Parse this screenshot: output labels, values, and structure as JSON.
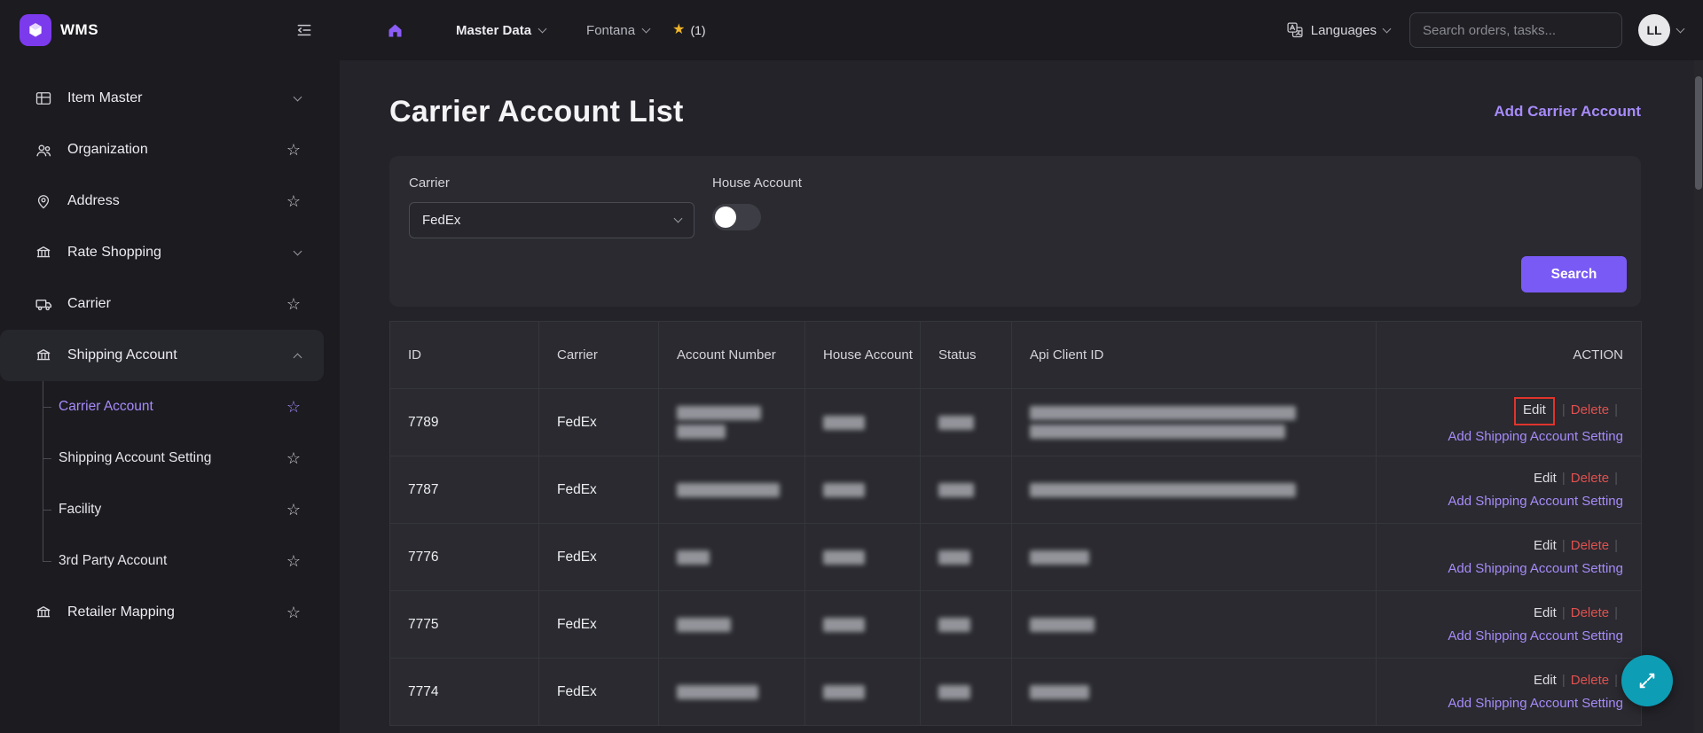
{
  "app": {
    "name": "WMS"
  },
  "topbar": {
    "master_data": "Master Data",
    "facility": "Fontana",
    "favorites_count": "(1)",
    "languages_label": "Languages",
    "search_placeholder": "Search orders, tasks...",
    "avatar_initials": "LL"
  },
  "sidebar": {
    "items": [
      {
        "label": "Item Master",
        "icon": "grid-icon",
        "trailing": "chevron-down"
      },
      {
        "label": "Organization",
        "icon": "team-icon",
        "trailing": "star"
      },
      {
        "label": "Address",
        "icon": "map-pin-icon",
        "trailing": "star"
      },
      {
        "label": "Rate Shopping",
        "icon": "bank-icon",
        "trailing": "chevron-down"
      },
      {
        "label": "Carrier",
        "icon": "truck-icon",
        "trailing": "star"
      },
      {
        "label": "Shipping Account",
        "icon": "bank-icon",
        "trailing": "chevron-up",
        "expanded": true
      },
      {
        "label": "Retailer Mapping",
        "icon": "bank-icon",
        "trailing": "star"
      }
    ],
    "shipping_children": [
      {
        "label": "Carrier Account",
        "active": true
      },
      {
        "label": "Shipping Account Setting"
      },
      {
        "label": "Facility"
      },
      {
        "label": "3rd Party Account"
      }
    ]
  },
  "page": {
    "title": "Carrier Account List",
    "add_link": "Add Carrier Account"
  },
  "filters": {
    "carrier_label": "Carrier",
    "carrier_value": "FedEx",
    "house_account_label": "House Account",
    "house_account_on": false,
    "search_button": "Search"
  },
  "table": {
    "headers": [
      "ID",
      "Carrier",
      "Account Number",
      "House Account",
      "Status",
      "Api Client ID",
      "ACTION"
    ],
    "rows": [
      {
        "id": "7789",
        "carrier": "FedEx"
      },
      {
        "id": "7787",
        "carrier": "FedEx"
      },
      {
        "id": "7776",
        "carrier": "FedEx"
      },
      {
        "id": "7775",
        "carrier": "FedEx"
      },
      {
        "id": "7774",
        "carrier": "FedEx"
      }
    ],
    "actions": {
      "edit": "Edit",
      "delete": "Delete",
      "add_setting": "Add Shipping Account Setting",
      "separator": "|"
    },
    "redacted_columns": [
      "Account Number",
      "House Account",
      "Status",
      "Api Client ID"
    ]
  },
  "colors": {
    "accent_purple": "#7a5af5",
    "link_purple": "#a78bfa",
    "delete_red": "#e0514f",
    "annotation_red": "#e0342c",
    "fab_teal": "#0d9db5",
    "star_gold": "#f0b429",
    "topbar_bg": "#1b1b20",
    "main_bg": "#232329",
    "panel_bg": "#2a2a30"
  }
}
